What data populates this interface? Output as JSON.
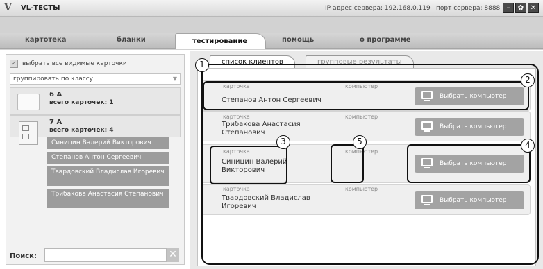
{
  "titlebar": {
    "logo": "V",
    "app_title": "VL-ТЕСТЫ",
    "server_ip": "IP адрес сервера: 192.168.0.119",
    "server_port": "порт сервера: 8888",
    "buttons": {
      "minimize": "–",
      "settings": "✿",
      "close": "✕"
    }
  },
  "nav": {
    "tabs": [
      {
        "label": "картотека"
      },
      {
        "label": "бланки"
      },
      {
        "label": "тестирование"
      },
      {
        "label": "помощь"
      },
      {
        "label": "о программе"
      }
    ],
    "active_tab": "тестирование"
  },
  "left": {
    "select_all": {
      "label": "выбрать все видимые карточки",
      "checked": true,
      "mark": "✓"
    },
    "grouping": {
      "value": "группировать по классу",
      "arrow": "▼"
    },
    "classes": [
      {
        "name": "6 А",
        "count": "всего карточек: 1",
        "students": []
      },
      {
        "name": "7 А",
        "count": "всего карточек: 4",
        "students": [
          "Синицин Валерий Викторович",
          "Степанов Антон Сергеевич",
          "Твардовский Владислав Игоревич",
          "Трибакова Анастасия Степанович"
        ]
      }
    ],
    "search": {
      "label": "Поиск:",
      "value": "",
      "clear": "✕"
    }
  },
  "right": {
    "subtabs": [
      {
        "label": "список клиентов",
        "active": true
      },
      {
        "label": "групповые результаты",
        "active": false
      }
    ],
    "field_labels": {
      "card": "карточка",
      "computer": "компьютер"
    },
    "rows": [
      {
        "name": "Степанов Антон Сергеевич",
        "button": "Выбрать компьютер"
      },
      {
        "name": "Трибакова Анастасия Степанович",
        "button": "Выбрать компьютер"
      },
      {
        "name": "Синицин Валерий Викторович",
        "button": "Выбрать компьютер"
      },
      {
        "name": "Твардовский Владислав Игоревич",
        "button": "Выбрать компьютер"
      }
    ]
  },
  "callouts": [
    "1",
    "2",
    "3",
    "4",
    "5"
  ],
  "colors": {
    "button_gray": "#a3a3a3",
    "student_gray": "#9c9c9c",
    "panel_bg": "#e9e9e9"
  }
}
